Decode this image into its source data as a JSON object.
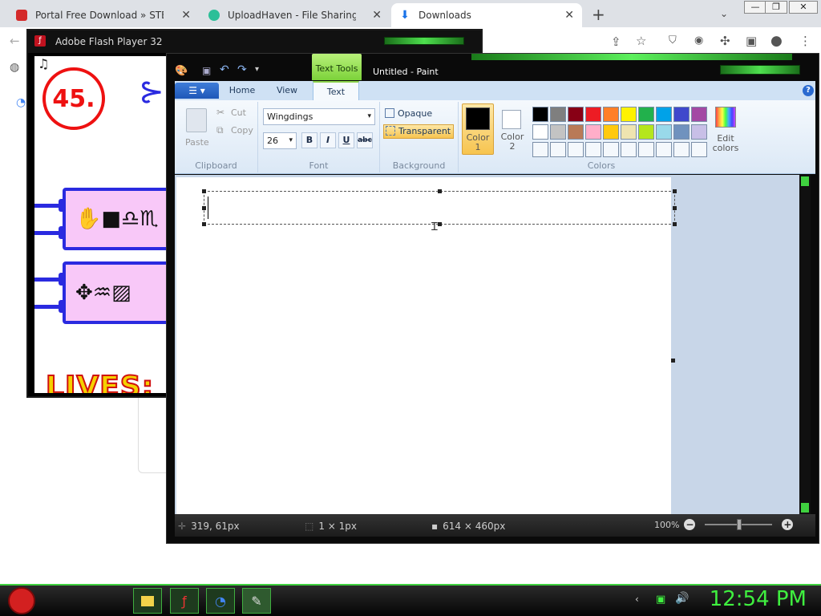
{
  "browser": {
    "tabs": [
      {
        "title": "Portal Free Download » STEAMU",
        "icon": "redirect-icon"
      },
      {
        "title": "UploadHaven - File Sharing Mad",
        "icon": "uploadhaven-icon"
      },
      {
        "title": "Downloads",
        "icon": "download-icon"
      }
    ],
    "new_tab": "+",
    "minimize": "—",
    "restore": "❐",
    "close": "✕"
  },
  "flash": {
    "title": "Adobe Flash Player 32",
    "level": "45.",
    "glyph_row1": "✋■♎♏",
    "glyph_row2": "✥♒▨",
    "lives_label": "LIVES:"
  },
  "paint": {
    "title": "Untitled - Paint",
    "contextual_tab": "Text Tools",
    "tabs": {
      "home": "Home",
      "view": "View",
      "text": "Text"
    },
    "clipboard": {
      "paste": "Paste",
      "cut": "Cut",
      "copy": "Copy",
      "label": "Clipboard"
    },
    "font": {
      "family": "Wingdings",
      "size": "26",
      "bold": "B",
      "italic": "I",
      "underline": "U",
      "strike": "abc",
      "label": "Font"
    },
    "background": {
      "opaque": "Opaque",
      "transparent": "Transparent",
      "label": "Background"
    },
    "colors": {
      "color1": "Color 1",
      "color2": "Color 2",
      "edit": "Edit colors",
      "label": "Colors",
      "palette_row1": [
        "#000000",
        "#7f7f7f",
        "#880015",
        "#ed1c24",
        "#ff7f27",
        "#fff200",
        "#22b14c",
        "#00a2e8",
        "#3f48cc",
        "#a349a4"
      ],
      "palette_row2": [
        "#ffffff",
        "#c3c3c3",
        "#b97a57",
        "#ffaec9",
        "#ffc90e",
        "#efe4b0",
        "#b5e61d",
        "#99d9ea",
        "#7092be",
        "#c8bfe7"
      ],
      "color1_value": "#000000",
      "color2_value": "#ffffff"
    },
    "status": {
      "cursor": "319, 61px",
      "selection": "1 × 1px",
      "size": "614 × 460px",
      "zoom": "100%"
    }
  },
  "taskbar": {
    "clock": "12:54 PM"
  }
}
